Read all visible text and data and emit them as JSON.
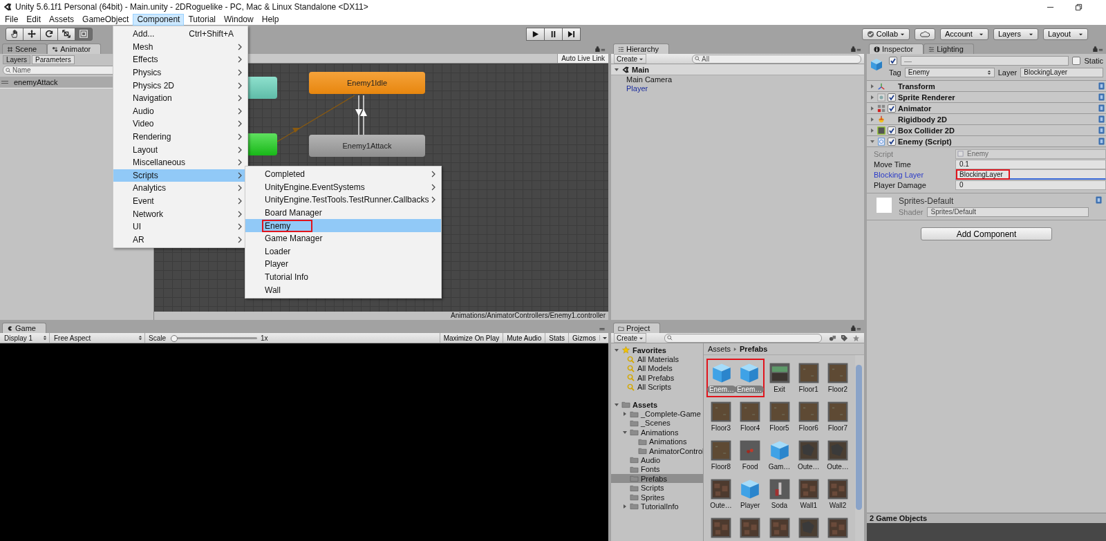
{
  "window": {
    "title": "Unity 5.6.1f1 Personal (64bit) - Main.unity - 2DRoguelike - PC, Mac & Linux Standalone <DX11>"
  },
  "menu_bar": [
    {
      "label": "File",
      "selected": false
    },
    {
      "label": "Edit",
      "selected": false
    },
    {
      "label": "Assets",
      "selected": false
    },
    {
      "label": "GameObject",
      "selected": false
    },
    {
      "label": "Component",
      "selected": true
    },
    {
      "label": "Tutorial",
      "selected": false
    },
    {
      "label": "Window",
      "selected": false
    },
    {
      "label": "Help",
      "selected": false
    }
  ],
  "component_menu": [
    {
      "label": "Add...",
      "shortcut": "Ctrl+Shift+A",
      "submenu": false,
      "selected": false
    },
    {
      "label": "Mesh",
      "submenu": true,
      "selected": false
    },
    {
      "label": "Effects",
      "submenu": true,
      "selected": false
    },
    {
      "label": "Physics",
      "submenu": true,
      "selected": false
    },
    {
      "label": "Physics 2D",
      "submenu": true,
      "selected": false
    },
    {
      "label": "Navigation",
      "submenu": true,
      "selected": false
    },
    {
      "label": "Audio",
      "submenu": true,
      "selected": false
    },
    {
      "label": "Video",
      "submenu": true,
      "selected": false
    },
    {
      "label": "Rendering",
      "submenu": true,
      "selected": false
    },
    {
      "label": "Layout",
      "submenu": true,
      "selected": false
    },
    {
      "label": "Miscellaneous",
      "submenu": true,
      "selected": false
    },
    {
      "label": "Scripts",
      "submenu": true,
      "selected": true
    },
    {
      "label": "Analytics",
      "submenu": true,
      "selected": false
    },
    {
      "label": "Event",
      "submenu": true,
      "selected": false
    },
    {
      "label": "Network",
      "submenu": true,
      "selected": false
    },
    {
      "label": "UI",
      "submenu": true,
      "selected": false
    },
    {
      "label": "AR",
      "submenu": true,
      "selected": false
    }
  ],
  "scripts_submenu": [
    {
      "label": "Completed",
      "submenu": true,
      "selected": false,
      "marked": false
    },
    {
      "label": "UnityEngine.EventSystems",
      "submenu": true,
      "selected": false,
      "marked": false
    },
    {
      "label": "UnityEngine.TestTools.TestRunner.Callbacks",
      "submenu": true,
      "selected": false,
      "marked": false
    },
    {
      "label": "Board Manager",
      "submenu": false,
      "selected": false,
      "marked": false
    },
    {
      "label": "Enemy",
      "submenu": false,
      "selected": true,
      "marked": true
    },
    {
      "label": "Game Manager",
      "submenu": false,
      "selected": false,
      "marked": false
    },
    {
      "label": "Loader",
      "submenu": false,
      "selected": false,
      "marked": false
    },
    {
      "label": "Player",
      "submenu": false,
      "selected": false,
      "marked": false
    },
    {
      "label": "Tutorial Info",
      "submenu": false,
      "selected": false,
      "marked": false
    },
    {
      "label": "Wall",
      "submenu": false,
      "selected": false,
      "marked": false
    }
  ],
  "toolbar": {
    "tools": [
      {
        "kind": "hand",
        "selected": false
      },
      {
        "kind": "move",
        "selected": false
      },
      {
        "kind": "rotate",
        "selected": false
      },
      {
        "kind": "scale",
        "selected": false
      },
      {
        "kind": "rect",
        "selected": true
      }
    ],
    "collab": "Collab",
    "account": "Account",
    "layers": "Layers",
    "layout": "Layout"
  },
  "animator": {
    "tabs": [
      {
        "label": "Scene",
        "kind": "scene",
        "selected": false
      },
      {
        "label": "Animator",
        "kind": "animator",
        "selected": true
      }
    ],
    "subtabs": [
      {
        "label": "Layers",
        "selected": false
      },
      {
        "label": "Parameters",
        "selected": true
      }
    ],
    "search": {
      "placeholder": "Name"
    },
    "parameters": [
      {
        "name": "enemyAttack"
      }
    ],
    "auto_live_link": "Auto Live Link",
    "states": [
      {
        "kind": "entry"
      },
      {
        "kind": "any"
      },
      {
        "label": "Enemy1Idle",
        "kind": "default"
      },
      {
        "label": "Enemy1Attack",
        "kind": "normal"
      }
    ],
    "path": "Animations/AnimatorControllers/Enemy1.controller"
  },
  "hierarchy": {
    "tab": "Hierarchy",
    "create": "Create",
    "search": {
      "placeholder": "All"
    },
    "scene": "Main",
    "items": [
      {
        "label": "Main Camera",
        "prefab": false
      },
      {
        "label": "Player",
        "prefab": true
      }
    ]
  },
  "inspector": {
    "tabs": [
      {
        "label": "Inspector",
        "kind": "info",
        "selected": true
      },
      {
        "label": "Lighting",
        "kind": "lighting",
        "selected": false
      }
    ],
    "active": true,
    "name": "—",
    "static": false,
    "static_label": "Static",
    "tag_label": "Tag",
    "tag": "Enemy",
    "layer_label": "Layer",
    "layer": "BlockingLayer",
    "components": [
      {
        "name": "Transform",
        "kind": "transform",
        "expanded": false
      },
      {
        "name": "Sprite Renderer",
        "kind": "sprite",
        "checked": true,
        "expanded": false
      },
      {
        "name": "Animator",
        "kind": "animator",
        "checked": true,
        "expanded": false
      },
      {
        "name": "Rigidbody 2D",
        "kind": "rigidbody",
        "expanded": false
      },
      {
        "name": "Box Collider 2D",
        "kind": "collider",
        "checked": true,
        "expanded": false
      },
      {
        "name": "Enemy (Script)",
        "kind": "script",
        "checked": true,
        "expanded": true
      }
    ],
    "fields": [
      {
        "label": "Script",
        "value": "Enemy",
        "disabled": true,
        "focused": false,
        "marked": false
      },
      {
        "label": "Move Time",
        "value": "0.1",
        "disabled": false,
        "focused": false,
        "marked": false
      },
      {
        "label": "Blocking Layer",
        "value": "BlockingLayer",
        "disabled": false,
        "focused": true,
        "marked": true
      },
      {
        "label": "Player Damage",
        "value": "0",
        "disabled": false,
        "focused": false,
        "marked": false
      }
    ],
    "material": {
      "name": "Sprites-Default",
      "shader_label": "Shader",
      "shader": "Sprites/Default"
    },
    "add_component": "Add Component",
    "preview": "2 Game Objects"
  },
  "game": {
    "tab": "Game",
    "display": "Display 1",
    "aspect": "Free Aspect",
    "scale_label": "Scale",
    "scale": {
      "level": 0
    },
    "scale_value": "1x",
    "buttons": [
      {
        "label": "Maximize On Play",
        "on": false
      },
      {
        "label": "Mute Audio",
        "on": false
      },
      {
        "label": "Stats",
        "on": false
      },
      {
        "label": "Gizmos",
        "on": false
      }
    ]
  },
  "project": {
    "tab": "Project",
    "create": "Create",
    "favorites": {
      "label": "Favorites",
      "expanded": true,
      "items": [
        {
          "label": "All Materials"
        },
        {
          "label": "All Models"
        },
        {
          "label": "All Prefabs"
        },
        {
          "label": "All Scripts"
        }
      ]
    },
    "assets": {
      "label": "Assets",
      "expanded": true,
      "children": [
        {
          "label": "_Complete-Game",
          "expanded": false,
          "selected": false
        },
        {
          "label": "_Scenes",
          "selected": false
        },
        {
          "label": "Animations",
          "expanded": true,
          "selected": false,
          "children": [
            {
              "label": "Animations",
              "selected": false
            },
            {
              "label": "AnimatorControl",
              "selected": false
            }
          ]
        },
        {
          "label": "Audio",
          "selected": false
        },
        {
          "label": "Fonts",
          "selected": false
        },
        {
          "label": "Prefabs",
          "selected": true
        },
        {
          "label": "Scripts",
          "selected": false
        },
        {
          "label": "Sprites",
          "selected": false
        },
        {
          "label": "TutorialInfo",
          "expanded": false,
          "selected": false
        }
      ]
    },
    "breadcrumb": [
      "Assets",
      "Prefabs"
    ],
    "items": [
      {
        "label": "Enem…",
        "kind": "cube",
        "selected": true,
        "marked": true
      },
      {
        "label": "Enem…",
        "kind": "cube",
        "selected": true,
        "marked": true
      },
      {
        "label": "Exit",
        "kind": "sign",
        "selected": false,
        "marked": false
      },
      {
        "label": "Floor1",
        "kind": "floor",
        "selected": false,
        "marked": false
      },
      {
        "label": "Floor2",
        "kind": "floor",
        "selected": false,
        "marked": false
      },
      {
        "label": "Floor3",
        "kind": "floor",
        "selected": false,
        "marked": false
      },
      {
        "label": "Floor4",
        "kind": "floor",
        "selected": false,
        "marked": false
      },
      {
        "label": "Floor5",
        "kind": "floor",
        "selected": false,
        "marked": false
      },
      {
        "label": "Floor6",
        "kind": "floor",
        "selected": false,
        "marked": false
      },
      {
        "label": "Floor7",
        "kind": "floor",
        "selected": false,
        "marked": false
      },
      {
        "label": "Floor8",
        "kind": "floor",
        "selected": false,
        "marked": false
      },
      {
        "label": "Food",
        "kind": "food",
        "selected": false,
        "marked": false
      },
      {
        "label": "Gam…",
        "kind": "cube",
        "selected": false,
        "marked": false
      },
      {
        "label": "Oute…",
        "kind": "rock",
        "selected": false,
        "marked": false
      },
      {
        "label": "Oute…",
        "kind": "rock",
        "selected": false,
        "marked": false
      },
      {
        "label": "Oute…",
        "kind": "wall",
        "selected": false,
        "marked": false
      },
      {
        "label": "Player",
        "kind": "cube",
        "selected": false,
        "marked": false
      },
      {
        "label": "Soda",
        "kind": "soda",
        "selected": false,
        "marked": false
      },
      {
        "label": "Wall1",
        "kind": "wall",
        "selected": false,
        "marked": false
      },
      {
        "label": "Wall2",
        "kind": "wall",
        "selected": false,
        "marked": false
      },
      {
        "kind": "wall",
        "marked": false
      },
      {
        "kind": "wall",
        "marked": false
      },
      {
        "kind": "wall",
        "marked": false
      },
      {
        "kind": "rock",
        "marked": false
      },
      {
        "kind": "wall",
        "marked": false
      }
    ]
  }
}
